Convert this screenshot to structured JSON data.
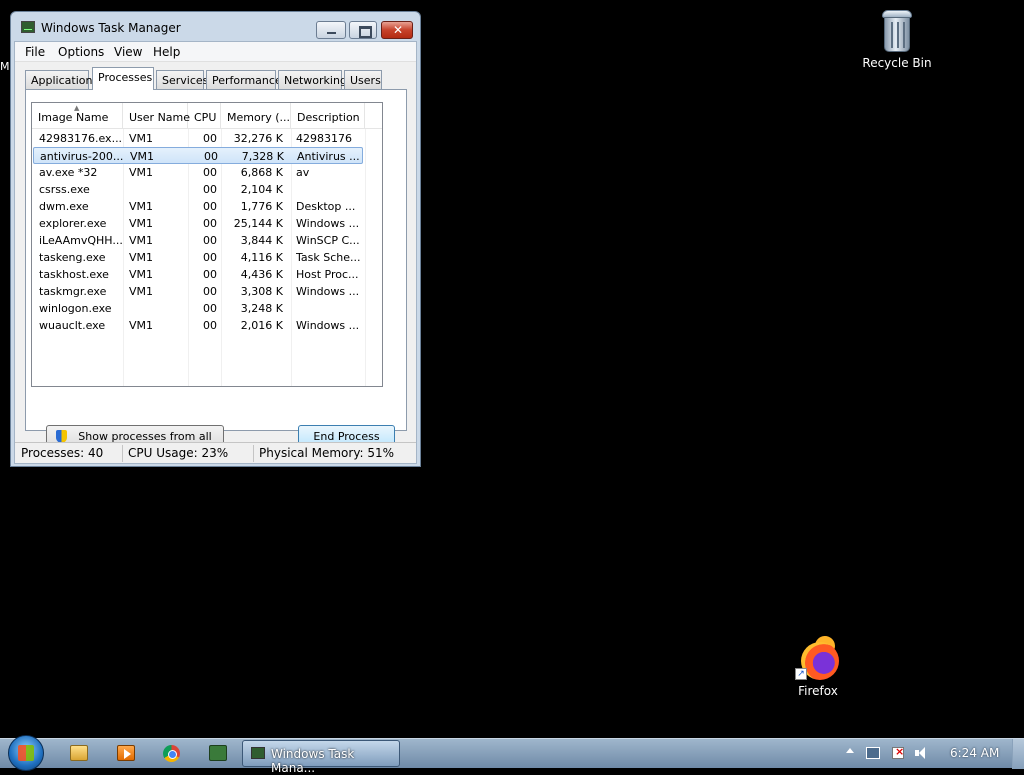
{
  "desktop": {
    "recycle_bin_label": "Recycle Bin",
    "firefox_label": "Firefox",
    "cut_label": "M"
  },
  "window": {
    "title": "Windows Task Manager",
    "menu": [
      "File",
      "Options",
      "View",
      "Help"
    ],
    "tabs": [
      "Applications",
      "Processes",
      "Services",
      "Performance",
      "Networking",
      "Users"
    ],
    "active_tab": "Processes"
  },
  "process_table": {
    "columns": [
      "Image Name",
      "User Name",
      "CPU",
      "Memory (...",
      "Description"
    ],
    "rows": [
      {
        "name": "42983176.ex...",
        "user": "VM1",
        "cpu": "00",
        "mem": "32,276 K",
        "desc": "42983176"
      },
      {
        "name": "antivirus-200...",
        "user": "VM1",
        "cpu": "00",
        "mem": "7,328 K",
        "desc": "Antivirus ..."
      },
      {
        "name": "av.exe *32",
        "user": "VM1",
        "cpu": "00",
        "mem": "6,868 K",
        "desc": "av"
      },
      {
        "name": "csrss.exe",
        "user": "",
        "cpu": "00",
        "mem": "2,104 K",
        "desc": ""
      },
      {
        "name": "dwm.exe",
        "user": "VM1",
        "cpu": "00",
        "mem": "1,776 K",
        "desc": "Desktop ..."
      },
      {
        "name": "explorer.exe",
        "user": "VM1",
        "cpu": "00",
        "mem": "25,144 K",
        "desc": "Windows ..."
      },
      {
        "name": "iLeAAmvQHH...",
        "user": "VM1",
        "cpu": "00",
        "mem": "3,844 K",
        "desc": "WinSCP C..."
      },
      {
        "name": "taskeng.exe",
        "user": "VM1",
        "cpu": "00",
        "mem": "4,116 K",
        "desc": "Task Sche..."
      },
      {
        "name": "taskhost.exe",
        "user": "VM1",
        "cpu": "00",
        "mem": "4,436 K",
        "desc": "Host Proc..."
      },
      {
        "name": "taskmgr.exe",
        "user": "VM1",
        "cpu": "00",
        "mem": "3,308 K",
        "desc": "Windows ..."
      },
      {
        "name": "winlogon.exe",
        "user": "",
        "cpu": "00",
        "mem": "3,248 K",
        "desc": ""
      },
      {
        "name": "wuauclt.exe",
        "user": "VM1",
        "cpu": "00",
        "mem": "2,016 K",
        "desc": "Windows ..."
      }
    ],
    "selected_row": 1
  },
  "buttons": {
    "show_all": "Show processes from all users",
    "end_process": "End Process"
  },
  "status": {
    "processes": "Processes: 40",
    "cpu": "CPU Usage: 23%",
    "memory": "Physical Memory: 51%"
  },
  "taskbar": {
    "task_label": "Windows Task Mana...",
    "clock": "6:24 AM"
  },
  "icons": {
    "start": "windows-start-icon",
    "explorer": "folder-icon",
    "media": "media-player-icon",
    "chrome": "chrome-icon",
    "tool": "terminal-tool-icon",
    "shield": "uac-shield-icon"
  }
}
